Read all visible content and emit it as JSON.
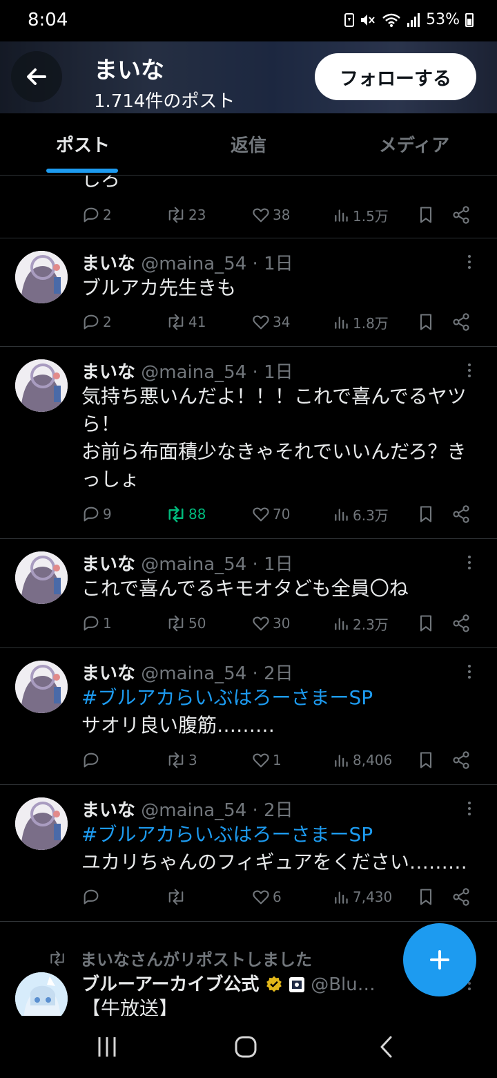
{
  "status_bar": {
    "time": "8:04",
    "battery_percent": "53%"
  },
  "header": {
    "name": "まいな",
    "post_count": "1.714件のポスト",
    "follow_label": "フォローする"
  },
  "tabs": [
    {
      "label": "ポスト",
      "active": true
    },
    {
      "label": "返信",
      "active": false
    },
    {
      "label": "メディア",
      "active": false
    }
  ],
  "partial_tweet": {
    "text_tail": "しろ",
    "replies": "2",
    "reposts": "23",
    "likes": "38",
    "views": "1.5万"
  },
  "tweets": [
    {
      "name": "まいな",
      "handle": "@maina_54",
      "age": "1日",
      "hashtag": "",
      "lines": [
        "ブルアカ先生きも"
      ],
      "replies": "2",
      "reposts": "41",
      "likes": "34",
      "views": "1.8万",
      "reposted": false
    },
    {
      "name": "まいな",
      "handle": "@maina_54",
      "age": "1日",
      "hashtag": "",
      "lines": [
        "気持ち悪いんだよ！！！これで喜んでるヤツ",
        "ら！",
        "お前ら布面積少なきゃそれでいいんだろ？き",
        "っしょ"
      ],
      "replies": "9",
      "reposts": "88",
      "likes": "70",
      "views": "6.3万",
      "reposted": true
    },
    {
      "name": "まいな",
      "handle": "@maina_54",
      "age": "1日",
      "hashtag": "",
      "lines": [
        "これで喜んでるキモオタども全員〇ね"
      ],
      "replies": "1",
      "reposts": "50",
      "likes": "30",
      "views": "2.3万",
      "reposted": false
    },
    {
      "name": "まいな",
      "handle": "@maina_54",
      "age": "2日",
      "hashtag": "#ブルアカらいぶはろーさまーSP",
      "lines": [
        "サオリ良い腹筋………"
      ],
      "replies": "",
      "reposts": "3",
      "likes": "1",
      "views": "8,406",
      "reposted": false
    },
    {
      "name": "まいな",
      "handle": "@maina_54",
      "age": "2日",
      "hashtag": "#ブルアカらいぶはろーさまーSP",
      "lines": [
        "ユカリちゃんのフィギュアをください………"
      ],
      "replies": "",
      "reposts": "",
      "likes": "6",
      "views": "7,430",
      "reposted": false
    }
  ],
  "repost_block": {
    "label": "まいなさんがリポストしました",
    "name": "ブルーアーカイブ公式",
    "handle": "@Blu…",
    "text": "【牛放送】"
  },
  "colors": {
    "accent": "#1d9bf0",
    "repost_green": "#00ba7c",
    "muted": "#71767b",
    "verified_gold": "#e2b719"
  },
  "icons": [
    "back-arrow-icon",
    "reply-icon",
    "repost-icon",
    "like-icon",
    "views-icon",
    "bookmark-icon",
    "share-icon",
    "more-icon",
    "compose-plus-icon",
    "verified-badge-icon"
  ]
}
